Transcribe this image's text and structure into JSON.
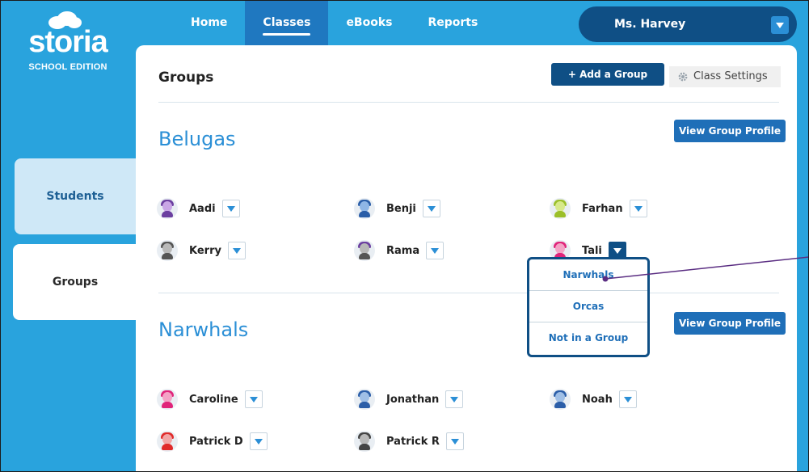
{
  "brand": {
    "name": "storia",
    "edition": "SCHOOL EDITION"
  },
  "nav": {
    "items": [
      "Home",
      "Classes",
      "eBooks",
      "Reports"
    ],
    "active": "Classes"
  },
  "user": {
    "name": "Ms. Harvey"
  },
  "sidebar": {
    "items": [
      "Students",
      "Groups"
    ],
    "active": "Groups"
  },
  "main": {
    "title": "Groups",
    "add_group_label": "+  Add a Group",
    "class_settings_label": "Class Settings",
    "profile_label": "View Group Profile"
  },
  "groups": [
    {
      "name": "Belugas",
      "students": [
        "Aadi",
        "Benji",
        "Farhan",
        "Kerry",
        "Rama",
        "Tali"
      ]
    },
    {
      "name": "Narwhals",
      "students": [
        "Caroline",
        "Jonathan",
        "Noah",
        "Patrick D",
        "Patrick R"
      ]
    }
  ],
  "dropdown": {
    "student": "Tali",
    "options": [
      "Narwhals",
      "Orcas",
      "Not in a Group"
    ]
  },
  "colors": {
    "background": "#29a3dd",
    "nav_active": "#1f78c0",
    "dark_blue": "#0f4f85",
    "group_title": "#2b8fd6",
    "callout_line": "#5a2d82"
  }
}
